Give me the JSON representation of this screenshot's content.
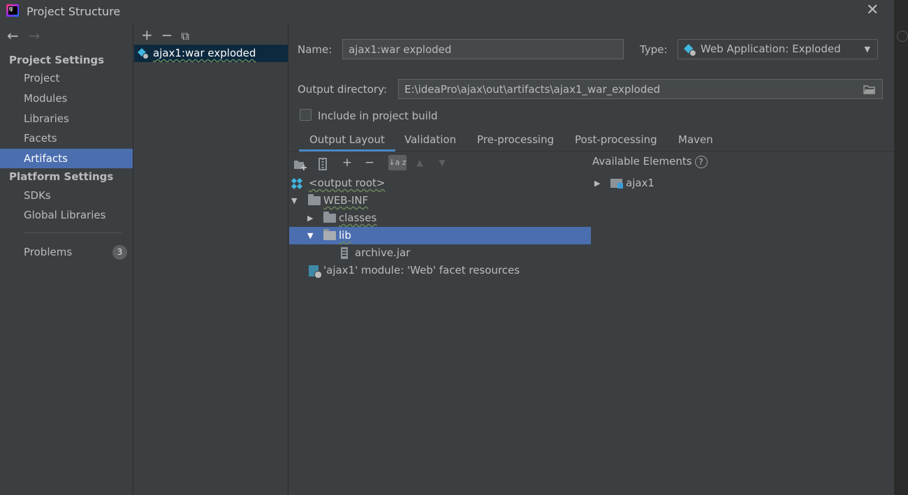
{
  "window": {
    "title": "Project Structure",
    "close_glyph": "✕"
  },
  "nav": {
    "back_glyph": "←",
    "forward_glyph": "→",
    "project_settings_header": "Project Settings",
    "platform_settings_header": "Platform Settings",
    "items": [
      {
        "label": "Project"
      },
      {
        "label": "Modules"
      },
      {
        "label": "Libraries"
      },
      {
        "label": "Facets"
      },
      {
        "label": "Artifacts",
        "selected": true
      },
      {
        "label": "SDKs"
      },
      {
        "label": "Global Libraries"
      },
      {
        "label": "Problems",
        "badge": "3"
      }
    ]
  },
  "artifacts": {
    "toolbar": {
      "add": "+",
      "remove": "−",
      "copy": "⧉"
    },
    "items": [
      {
        "label": "ajax1:war exploded",
        "selected": true
      }
    ]
  },
  "details": {
    "name_label": "Name:",
    "name_value": "ajax1:war exploded",
    "type_label": "Type:",
    "type_value": "Web Application: Exploded",
    "output_dir_label": "Output directory:",
    "output_dir_value": "E:\\ideaPro\\ajax\\out\\artifacts\\ajax1_war_exploded",
    "include_label": "Include in project build",
    "include_checked": false,
    "tabs": [
      {
        "label": "Output Layout",
        "active": true
      },
      {
        "label": "Validation"
      },
      {
        "label": "Pre-processing"
      },
      {
        "label": "Post-processing"
      },
      {
        "label": "Maven"
      }
    ]
  },
  "layout_toolbar": {
    "add_symbol": "+",
    "remove_symbol": "−",
    "sort_symbol": "↓a z",
    "move_up_symbol": "▲",
    "move_down_symbol": "▼"
  },
  "tree": {
    "output_root": "<output root>",
    "web_inf": "WEB-INF",
    "classes": "classes",
    "lib": "lib",
    "archive": "archive.jar",
    "facet_resources": "'ajax1' module: 'Web' facet resources"
  },
  "available": {
    "title": "Available Elements",
    "help": "?",
    "module": "ajax1"
  },
  "colors": {
    "background": "#3c3f41",
    "selection": "#4b6eaf",
    "list_selection": "#0d293e",
    "tab_underline": "#4a88c7"
  }
}
